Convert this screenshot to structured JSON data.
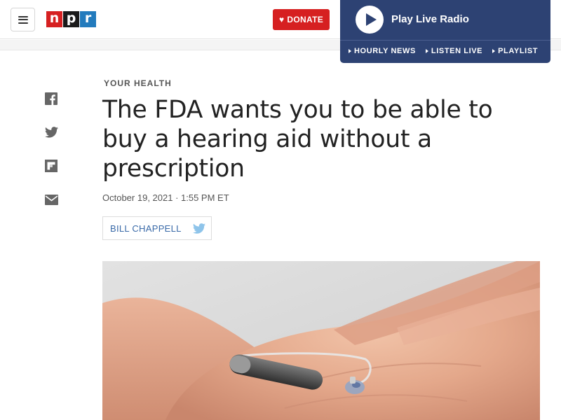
{
  "header": {
    "logo_letters": [
      "n",
      "p",
      "r"
    ],
    "donate_label": "DONATE",
    "colors": {
      "logo_n": "#d62021",
      "logo_p": "#1a1a1a",
      "logo_r": "#237bbd",
      "donate": "#d62021"
    }
  },
  "radio": {
    "title": "Play Live Radio",
    "links": [
      "HOURLY NEWS",
      "LISTEN LIVE",
      "PLAYLIST"
    ],
    "color": "#2d4273"
  },
  "share": {
    "icons": [
      "facebook-icon",
      "twitter-icon",
      "flipboard-icon",
      "email-icon"
    ]
  },
  "article": {
    "kicker": "YOUR HEALTH",
    "headline": "The FDA wants you to be able to buy a hearing aid without a prescription",
    "date": "October 19, 2021 · 1:55 PM ET",
    "author": "BILL CHAPPELL"
  }
}
